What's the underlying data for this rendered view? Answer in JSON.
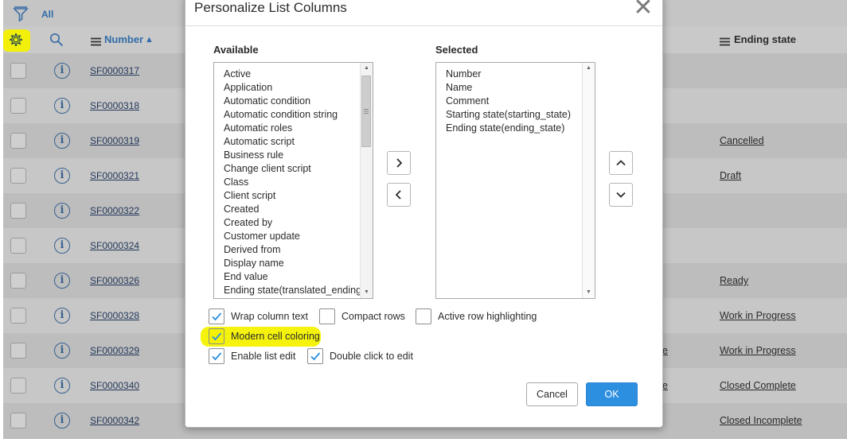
{
  "list": {
    "filter_label": "All",
    "header": {
      "number_label": "Number",
      "number_sort": "▲",
      "ending_state_label": "Ending state"
    },
    "rows": [
      {
        "number": "SF0000317",
        "ending_state": "",
        "mid": ""
      },
      {
        "number": "SF0000318",
        "ending_state": "",
        "mid": ""
      },
      {
        "number": "SF0000319",
        "ending_state": "Cancelled",
        "mid": ""
      },
      {
        "number": "SF0000321",
        "ending_state": "Draft",
        "mid": ""
      },
      {
        "number": "SF0000322",
        "ending_state": "",
        "mid": ""
      },
      {
        "number": "SF0000324",
        "ending_state": "",
        "mid": ""
      },
      {
        "number": "SF0000326",
        "ending_state": "Ready",
        "mid": ""
      },
      {
        "number": "SF0000328",
        "ending_state": "Work in Progress",
        "mid": ""
      },
      {
        "number": "SF0000329",
        "ending_state": "Work in Progress",
        "mid": "e"
      },
      {
        "number": "SF0000340",
        "ending_state": "Closed Complete",
        "mid": "e"
      },
      {
        "number": "SF0000342",
        "ending_state": "Closed Incomplete",
        "mid": ""
      }
    ],
    "info_glyph": "i",
    "highlight_color": "#f4f200"
  },
  "modal": {
    "title": "Personalize List Columns",
    "close_glyph": "✕",
    "available_label": "Available",
    "selected_label": "Selected",
    "available_items": [
      "Active",
      "Application",
      "Automatic condition",
      "Automatic condition string",
      "Automatic roles",
      "Automatic script",
      "Business rule",
      "Change client script",
      "Class",
      "Client script",
      "Created",
      "Created by",
      "Customer update",
      "Derived from",
      "Display name",
      "End value",
      "Ending state(translated_ending"
    ],
    "selected_items": [
      "Number",
      "Name",
      "Comment",
      "Starting state(starting_state)",
      "Ending state(ending_state)"
    ],
    "options": {
      "wrap_column_text": {
        "label": "Wrap column text",
        "checked": true
      },
      "compact_rows": {
        "label": "Compact rows",
        "checked": false
      },
      "active_row_highlighting": {
        "label": "Active row highlighting",
        "checked": false
      },
      "modern_cell_coloring": {
        "label": "Modern cell coloring",
        "checked": true
      },
      "enable_list_edit": {
        "label": "Enable list edit",
        "checked": true
      },
      "double_click_to_edit": {
        "label": "Double click to edit",
        "checked": true
      }
    },
    "cancel_label": "Cancel",
    "ok_label": "OK",
    "accent_color": "#2d8fe0"
  }
}
